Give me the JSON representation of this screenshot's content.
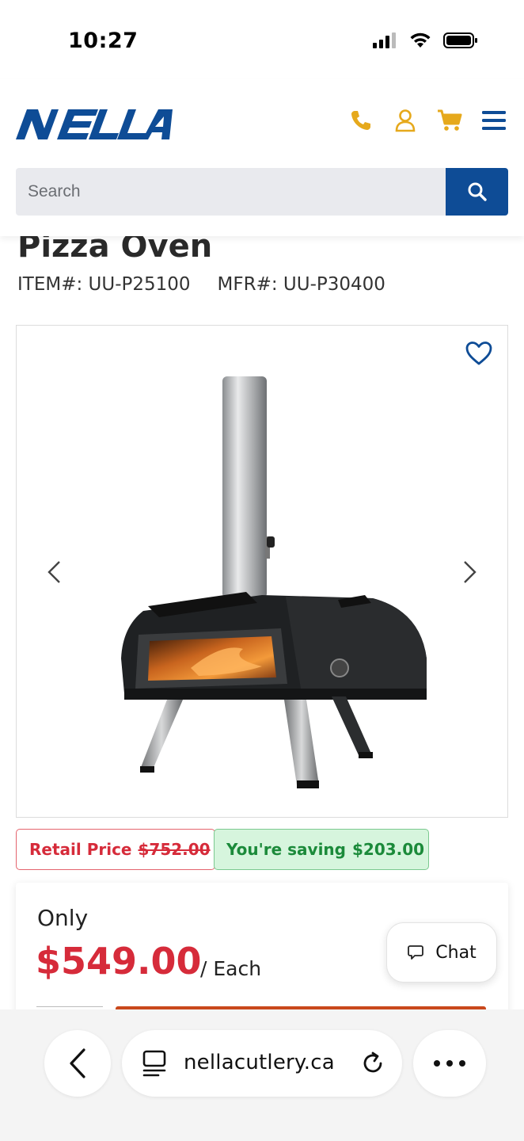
{
  "status_bar": {
    "time": "10:27"
  },
  "header": {
    "logo_text": "NELLA",
    "brand_color": "#0e4c96",
    "icon_color": "#e6a91c",
    "icons": [
      "phone-icon",
      "account-icon",
      "cart-icon",
      "menu-icon"
    ],
    "search": {
      "placeholder": "Search"
    }
  },
  "product": {
    "title": "Pizza Oven",
    "item_label": "ITEM#: UU-P25100",
    "mfr_label": "MFR#: UU-P30400",
    "retail_label": "Retail Price",
    "retail_price": "$752.00",
    "saving_label": "You're saving",
    "saving_amount": "$203.00",
    "only_label": "Only",
    "price": "$549.00",
    "unit": "/ Each"
  },
  "chat": {
    "label": "Chat"
  },
  "browser": {
    "url": "nellacutlery.ca"
  },
  "colors": {
    "price_red": "#d62b3a",
    "saving_green": "#1b8a3a"
  }
}
